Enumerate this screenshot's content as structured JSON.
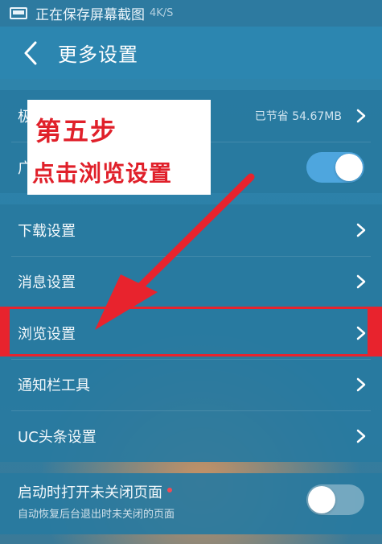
{
  "status_bar": {
    "text": "正在保存屏幕截图",
    "speed": "4K/S"
  },
  "header": {
    "title": "更多设置"
  },
  "group1": {
    "row1": {
      "label": "极",
      "value": "已节省 54.67MB"
    },
    "row2": {
      "label": "广",
      "toggle_on": true
    }
  },
  "group2": {
    "items": [
      {
        "label": "下载设置"
      },
      {
        "label": "消息设置"
      },
      {
        "label": "浏览设置"
      },
      {
        "label": "通知栏工具"
      },
      {
        "label": "UC头条设置"
      }
    ]
  },
  "group3": {
    "title": "启动时打开未关闭页面",
    "subtitle": "自动恢复后台退出时未关闭的页面",
    "toggle_on": false
  },
  "annotation": {
    "line1": "第五步",
    "line2": "点击浏览设置"
  },
  "colors": {
    "accent_red": "#e0202a",
    "header": "#2c86b0",
    "toggle_on": "#4ea6de"
  },
  "icons": [
    "screenshot-icon",
    "back-arrow-icon",
    "chevron-right-icon",
    "red-arrow"
  ]
}
